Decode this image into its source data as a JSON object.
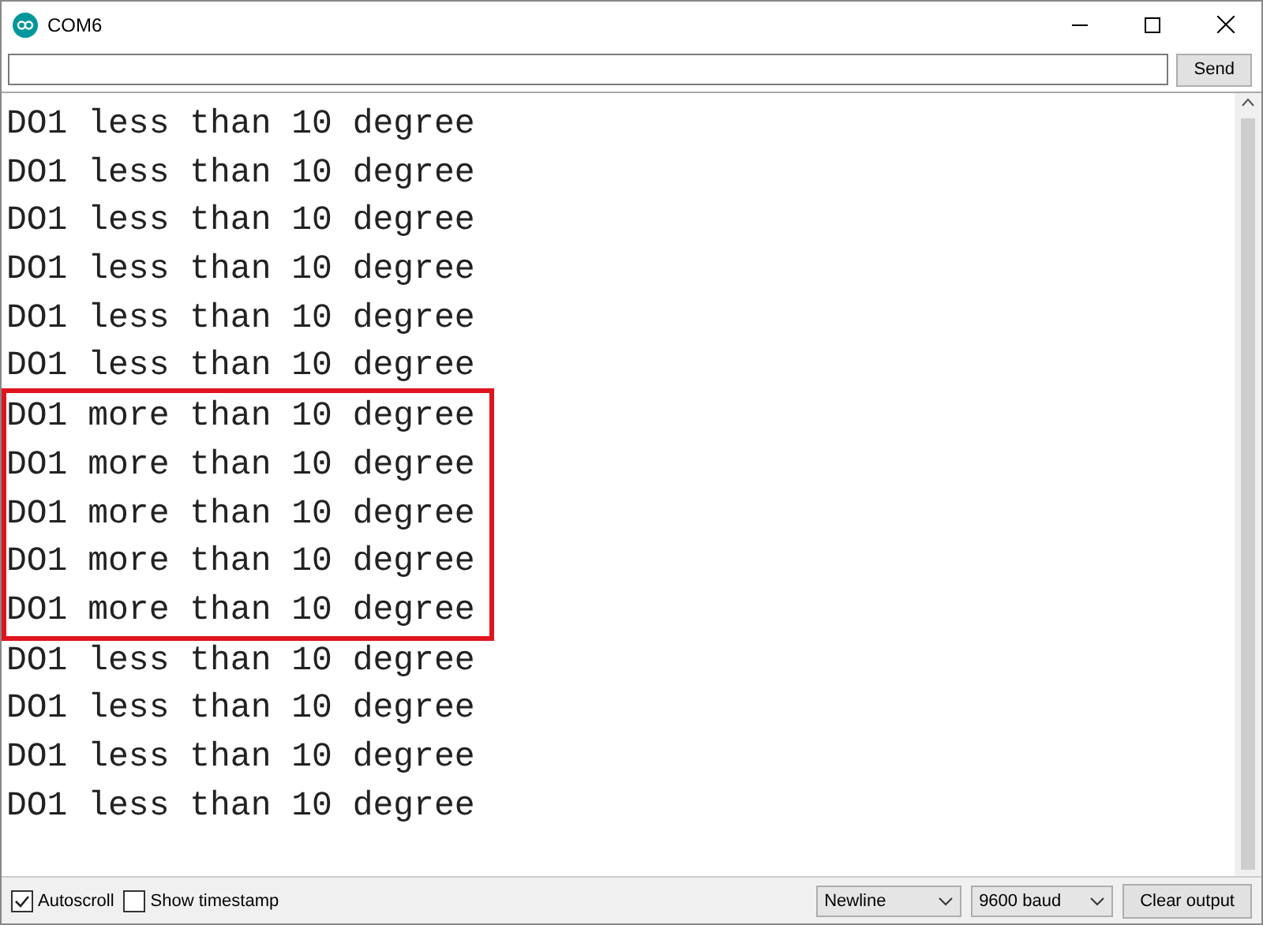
{
  "window": {
    "title": "COM6"
  },
  "input": {
    "button": "Send"
  },
  "lines": [
    {
      "text": "DO1 less than 10 degree",
      "highlighted": false
    },
    {
      "text": "DO1 less than 10 degree",
      "highlighted": false
    },
    {
      "text": "DO1 less than 10 degree",
      "highlighted": false
    },
    {
      "text": "DO1 less than 10 degree",
      "highlighted": false
    },
    {
      "text": "DO1 less than 10 degree",
      "highlighted": false
    },
    {
      "text": "DO1 less than 10 degree",
      "highlighted": false
    },
    {
      "text": "DO1 more than 10 degree",
      "highlighted": true
    },
    {
      "text": "DO1 more than 10 degree",
      "highlighted": true
    },
    {
      "text": "DO1 more than 10 degree",
      "highlighted": true
    },
    {
      "text": "DO1 more than 10 degree",
      "highlighted": true
    },
    {
      "text": "DO1 more than 10 degree",
      "highlighted": true
    },
    {
      "text": "DO1 less than 10 degree",
      "highlighted": false
    },
    {
      "text": "DO1 less than 10 degree",
      "highlighted": false
    },
    {
      "text": "DO1 less than 10 degree",
      "highlighted": false
    },
    {
      "text": "DO1 less than 10 degree",
      "highlighted": false
    }
  ],
  "status_bar": {
    "autoscroll": {
      "label": "Autoscroll",
      "checked": true
    },
    "timestamp": {
      "label": "Show timestamp",
      "checked": false
    },
    "line_ending": "Newline",
    "baud": "9600 baud",
    "clear_button": "Clear output"
  }
}
